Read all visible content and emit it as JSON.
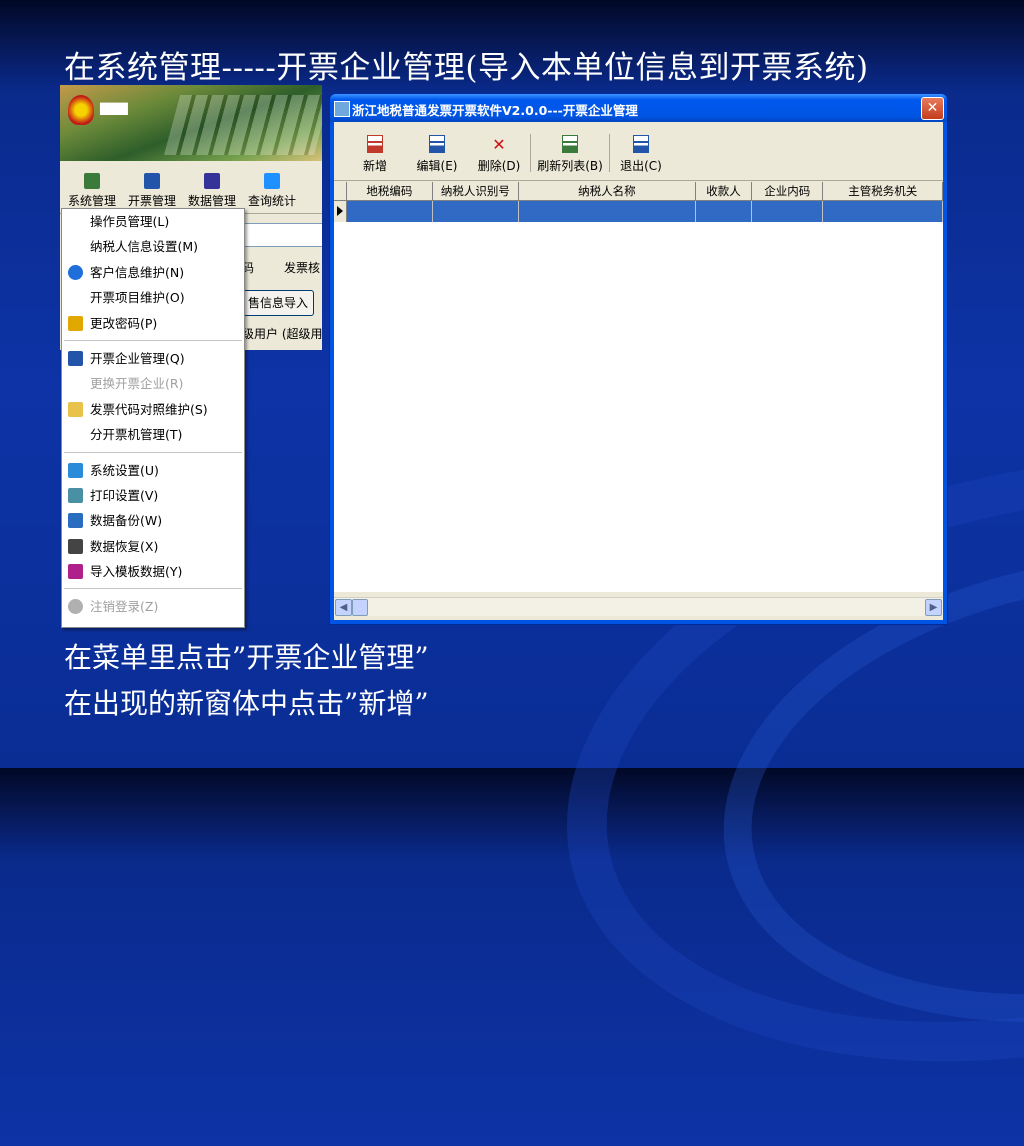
{
  "slide": {
    "title": "在系统管理-----开票企业管理(导入本单位信息到开票系统)",
    "caption1": "在菜单里点击”开票企业管理”",
    "caption2": "在出现的新窗体中点击”新增”"
  },
  "left_app": {
    "toolbar": [
      {
        "label": "系统管理",
        "icon": "system-icon",
        "color": "#3a7a3a"
      },
      {
        "label": "开票管理",
        "icon": "invoice-icon",
        "color": "#2255aa"
      },
      {
        "label": "数据管理",
        "icon": "disk-icon",
        "color": "#333399"
      },
      {
        "label": "查询统计",
        "icon": "search-icon",
        "color": "#1e90ff"
      }
    ],
    "fragment_col1": "码",
    "fragment_col2": "发票核",
    "fragment_button": "售信息导入",
    "fragment_user": "级用户 (超级用"
  },
  "menu": {
    "items": [
      {
        "label": "操作员管理(L)",
        "icon": "",
        "disabled": false
      },
      {
        "label": "纳税人信息设置(M)",
        "icon": "",
        "disabled": false
      },
      {
        "label": "客户信息维护(N)",
        "icon": "globe-icon",
        "disabled": false
      },
      {
        "label": "开票项目维护(O)",
        "icon": "",
        "disabled": false
      },
      {
        "label": "更改密码(P)",
        "icon": "key-icon",
        "disabled": false
      },
      {
        "label": "开票企业管理(Q)",
        "icon": "document-icon",
        "disabled": false
      },
      {
        "label": "更换开票企业(R)",
        "icon": "",
        "disabled": true
      },
      {
        "label": "发票代码对照维护(S)",
        "icon": "folder-icon",
        "disabled": false
      },
      {
        "label": "分开票机管理(T)",
        "icon": "",
        "disabled": false
      },
      {
        "label": "系统设置(U)",
        "icon": "gear-icon",
        "disabled": false
      },
      {
        "label": "打印设置(V)",
        "icon": "tools-icon",
        "disabled": false
      },
      {
        "label": "数据备份(W)",
        "icon": "pencil-icon",
        "disabled": false
      },
      {
        "label": "数据恢复(X)",
        "icon": "restore-icon",
        "disabled": false
      },
      {
        "label": "导入模板数据(Y)",
        "icon": "import-icon",
        "disabled": false
      },
      {
        "label": "注销登录(Z)",
        "icon": "logout-icon",
        "disabled": true
      }
    ]
  },
  "window": {
    "title": "浙江地税普通发票开票软件V2.0.0---开票企业管理",
    "toolbar": [
      {
        "label": "新增",
        "icon": "add-icon",
        "color": "#c0392b"
      },
      {
        "label": "编辑(E)",
        "icon": "edit-icon",
        "color": "#2255aa"
      },
      {
        "label": "删除(D)",
        "icon": "delete-icon",
        "color": "#d01010"
      },
      {
        "label": "刷新列表(B)",
        "icon": "refresh-icon",
        "color": "#3a7a3a"
      },
      {
        "label": "退出(C)",
        "icon": "exit-icon",
        "color": "#2255aa"
      }
    ],
    "columns": [
      "地税编码",
      "纳税人识别号",
      "纳税人名称",
      "收款人",
      "企业内码",
      "主管税务机关"
    ]
  },
  "colors": {
    "accent": "#0054e3",
    "selection": "#316ac5"
  }
}
